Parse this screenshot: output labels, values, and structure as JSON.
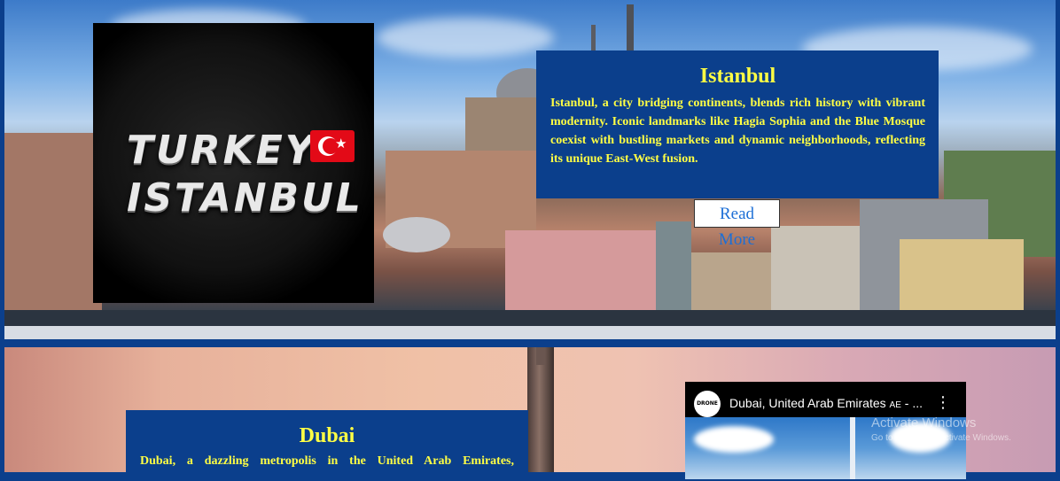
{
  "istanbul": {
    "logo_line1": "TURKEY",
    "logo_line2": "ISTANBUL",
    "flag_icon": "turkey-flag-icon",
    "title": "Istanbul",
    "description": "Istanbul, a city bridging continents, blends rich history with vibrant modernity. Iconic landmarks like Hagia Sophia and the Blue Mosque coexist with bustling markets and dynamic neighborhoods, reflecting its unique East-West fusion.",
    "read_more_label": "Read More"
  },
  "dubai": {
    "title": "Dubai",
    "description": "Dubai, a dazzling metropolis in the United Arab Emirates,",
    "video": {
      "channel_icon_text": "DRONE",
      "title": "Dubai, United Arab Emirates",
      "title_suffix": "AE",
      "title_ellipsis": " - ...",
      "more_icon": "vertical-ellipsis-icon"
    }
  },
  "watermark": {
    "line1": "Activate Windows",
    "line2": "Go to Settings to activate Windows."
  },
  "colors": {
    "panel_bg": "#0b3f8c",
    "panel_text": "#ffff44",
    "link_blue": "#1d6fd6"
  }
}
